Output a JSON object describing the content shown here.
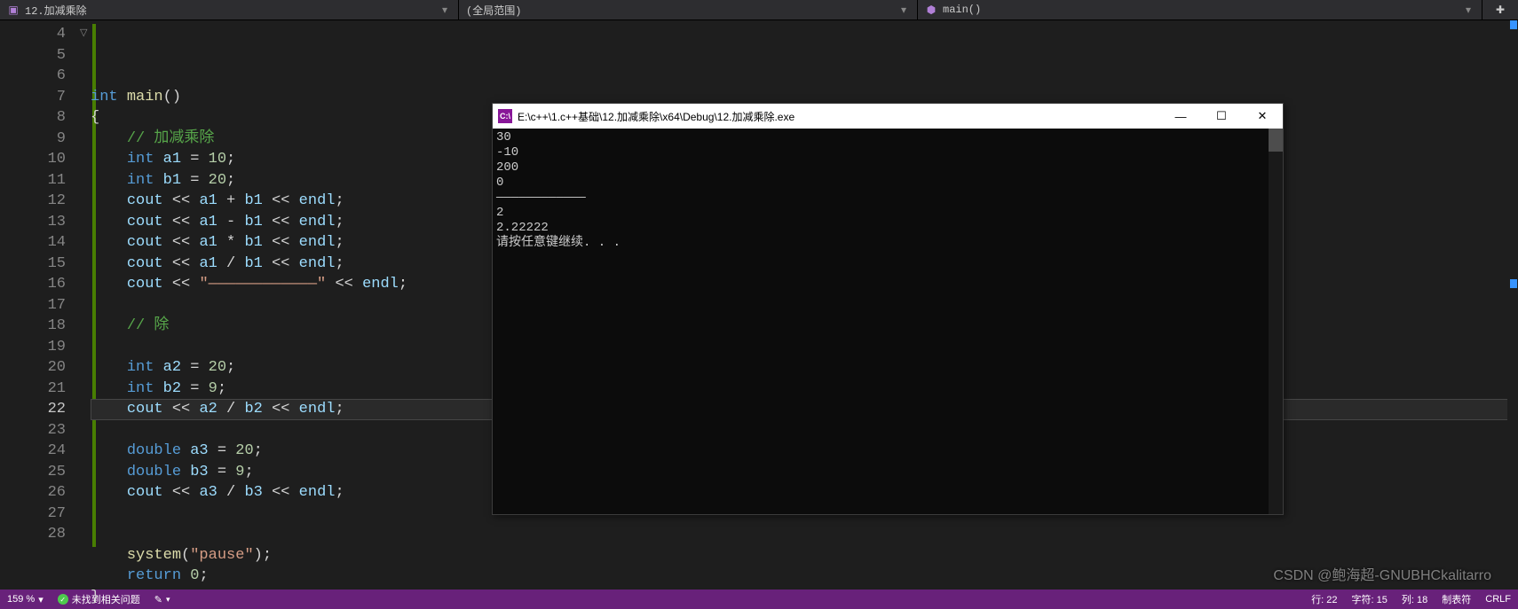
{
  "topbar": {
    "file_icon": "▣",
    "file_name": "12.加减乘除",
    "scope": "(全局范围)",
    "func_icon": "⬢",
    "func": "main()"
  },
  "gutter": {
    "start": 4,
    "end": 28,
    "current": 22
  },
  "code_lines": [
    {
      "n": 4,
      "html": "<span class='kw'>int</span> <span class='fn'>main</span><span class='op'>()</span>"
    },
    {
      "n": 5,
      "html": "<span class='op'>{</span>"
    },
    {
      "n": 6,
      "html": "    <span class='cm'>// 加减乘除</span>"
    },
    {
      "n": 7,
      "html": "    <span class='kw'>int</span> <span class='id'>a1</span> <span class='op'>=</span> <span class='nm'>10</span><span class='op'>;</span>"
    },
    {
      "n": 8,
      "html": "    <span class='kw'>int</span> <span class='id'>b1</span> <span class='op'>=</span> <span class='nm'>20</span><span class='op'>;</span>"
    },
    {
      "n": 9,
      "html": "    <span class='id'>cout</span> <span class='op'>&lt;&lt;</span> <span class='id'>a1</span> <span class='op'>+</span> <span class='id'>b1</span> <span class='op'>&lt;&lt;</span> <span class='id'>endl</span><span class='op'>;</span>"
    },
    {
      "n": 10,
      "html": "    <span class='id'>cout</span> <span class='op'>&lt;&lt;</span> <span class='id'>a1</span> <span class='op'>-</span> <span class='id'>b1</span> <span class='op'>&lt;&lt;</span> <span class='id'>endl</span><span class='op'>;</span>"
    },
    {
      "n": 11,
      "html": "    <span class='id'>cout</span> <span class='op'>&lt;&lt;</span> <span class='id'>a1</span> <span class='op'>*</span> <span class='id'>b1</span> <span class='op'>&lt;&lt;</span> <span class='id'>endl</span><span class='op'>;</span>"
    },
    {
      "n": 12,
      "html": "    <span class='id'>cout</span> <span class='op'>&lt;&lt;</span> <span class='id'>a1</span> <span class='op'>/</span> <span class='id'>b1</span> <span class='op'>&lt;&lt;</span> <span class='id'>endl</span><span class='op'>;</span>"
    },
    {
      "n": 13,
      "html": "    <span class='id'>cout</span> <span class='op'>&lt;&lt;</span> <span class='st'>&quot;————————————&quot;</span> <span class='op'>&lt;&lt;</span> <span class='id'>endl</span><span class='op'>;</span>"
    },
    {
      "n": 14,
      "html": ""
    },
    {
      "n": 15,
      "html": "    <span class='cm'>// 除</span>"
    },
    {
      "n": 16,
      "html": ""
    },
    {
      "n": 17,
      "html": "    <span class='kw'>int</span> <span class='id'>a2</span> <span class='op'>=</span> <span class='nm'>20</span><span class='op'>;</span>"
    },
    {
      "n": 18,
      "html": "    <span class='kw'>int</span> <span class='id'>b2</span> <span class='op'>=</span> <span class='nm'>9</span><span class='op'>;</span>"
    },
    {
      "n": 19,
      "html": "    <span class='id'>cout</span> <span class='op'>&lt;&lt;</span> <span class='id'>a2</span> <span class='op'>/</span> <span class='id'>b2</span> <span class='op'>&lt;&lt;</span> <span class='id'>endl</span><span class='op'>;</span>"
    },
    {
      "n": 20,
      "html": ""
    },
    {
      "n": 21,
      "html": "    <span class='kw'>double</span> <span class='id'>a3</span> <span class='op'>=</span> <span class='nm'>20</span><span class='op'>;</span>"
    },
    {
      "n": 22,
      "html": "    <span class='kw'>double</span> <span class='id'>b3</span> <span class='op'>=</span> <span class='nm'>9</span><span class='op'>;</span>"
    },
    {
      "n": 23,
      "html": "    <span class='id'>cout</span> <span class='op'>&lt;&lt;</span> <span class='id'>a3</span> <span class='op'>/</span> <span class='id'>b3</span> <span class='op'>&lt;&lt;</span> <span class='id'>endl</span><span class='op'>;</span>"
    },
    {
      "n": 24,
      "html": ""
    },
    {
      "n": 25,
      "html": ""
    },
    {
      "n": 26,
      "html": "    <span class='fn'>system</span><span class='op'>(</span><span class='st'>&quot;pause&quot;</span><span class='op'>);</span>"
    },
    {
      "n": 27,
      "html": "    <span class='kw'>return</span> <span class='nm'>0</span><span class='op'>;</span>"
    },
    {
      "n": 28,
      "html": "<span class='op'>}</span>"
    }
  ],
  "console": {
    "title": "E:\\c++\\1.c++基础\\12.加减乘除\\x64\\Debug\\12.加减乘除.exe",
    "icon_text": "C:\\",
    "lines": [
      "30",
      "-10",
      "200",
      "0",
      "————————————",
      "2",
      "2.22222",
      "请按任意键继续. . ."
    ],
    "min": "—",
    "max": "☐",
    "close": "✕"
  },
  "status": {
    "zoom": "159 %",
    "issues": "未找到相关问题",
    "brush": "✎",
    "line": "行: 22",
    "char": "字符: 15",
    "col": "列: 18",
    "tabs": "制表符",
    "crlf": "CRLF"
  },
  "watermark": "CSDN @鲍海超-GNUBHCkalitarro"
}
